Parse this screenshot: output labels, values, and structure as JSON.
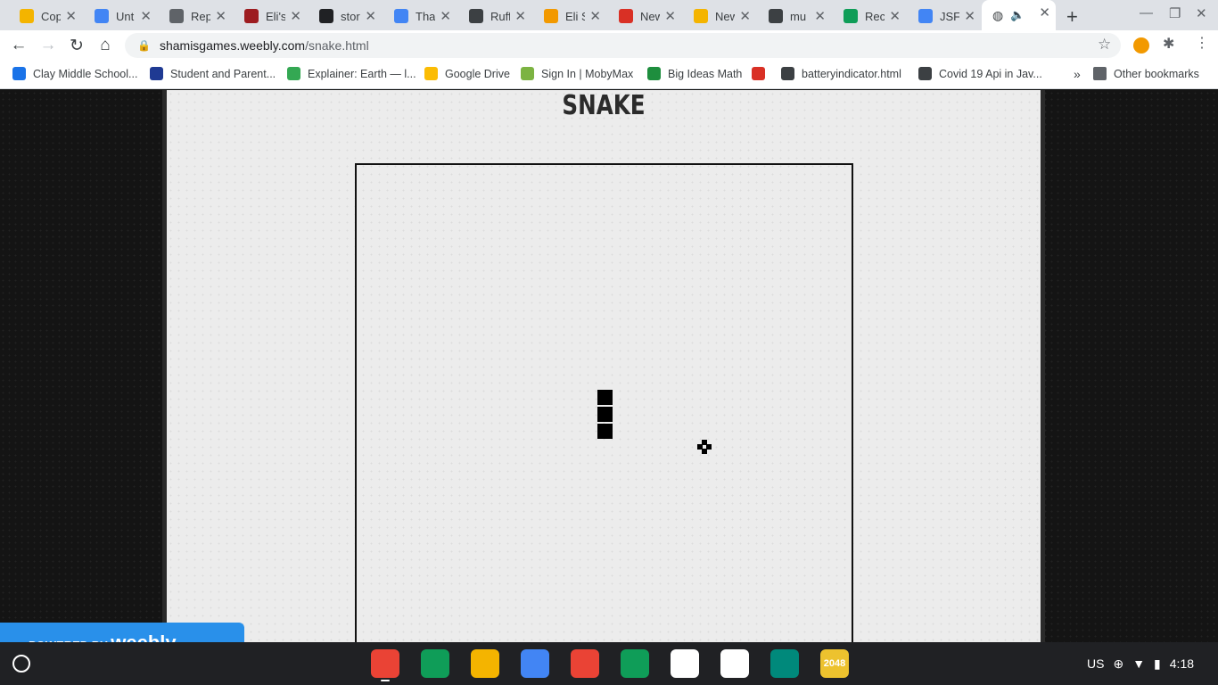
{
  "tabs": [
    {
      "title": "Cop",
      "icon": "slides-icon",
      "color": "#f4b400"
    },
    {
      "title": "Unt",
      "icon": "docs-icon",
      "color": "#4285f4"
    },
    {
      "title": "Rep",
      "icon": "replit-icon",
      "color": "#5f6368"
    },
    {
      "title": "Eli's",
      "icon": "flash-icon",
      "color": "#9d1c20"
    },
    {
      "title": "stor",
      "icon": "blackboard-icon",
      "color": "#202124"
    },
    {
      "title": "Tha",
      "icon": "docs-icon",
      "color": "#4285f4"
    },
    {
      "title": "Ruff",
      "icon": "globe-icon",
      "color": "#3c4043"
    },
    {
      "title": "Eli S",
      "icon": "scratch-icon",
      "color": "#f29900"
    },
    {
      "title": "New",
      "icon": "loading-icon",
      "color": "#d93025"
    },
    {
      "title": "New",
      "icon": "slides-icon",
      "color": "#f4b400"
    },
    {
      "title": "mu",
      "icon": "globe-icon",
      "color": "#3c4043"
    },
    {
      "title": "Rec",
      "icon": "drive-icon",
      "color": "#0f9d58"
    },
    {
      "title": "JSF",
      "icon": "cloud-icon",
      "color": "#4285f4"
    }
  ],
  "active_tab": {
    "icon": "globe-icon",
    "audio": "speaker-icon"
  },
  "omnibox": {
    "host": "shamisgames.weebly.com",
    "path": "/snake.html"
  },
  "bookmarks": [
    {
      "label": "Clay Middle School...",
      "color": "#1a73e8"
    },
    {
      "label": "Student and Parent...",
      "color": "#1f3a93"
    },
    {
      "label": "Explainer: Earth — l...",
      "color": "#34a853"
    },
    {
      "label": "Google Drive",
      "color": "#fbbc04"
    },
    {
      "label": "Sign In | MobyMax",
      "color": "#7cb342"
    },
    {
      "label": "Big Ideas Math",
      "color": "#1e8e3e"
    },
    {
      "label": "",
      "color": "#d93025"
    },
    {
      "label": "batteryindicator.html",
      "color": "#3c4043"
    },
    {
      "label": "Covid 19 Api in Jav...",
      "color": "#3c4043"
    }
  ],
  "bookmarks_more": "»",
  "other_bookmarks": "Other bookmarks",
  "page": {
    "title": "SNAKE",
    "badge_prefix": "POWERED BY",
    "badge_brand": "weebly"
  },
  "game": {
    "snake_length": 3
  },
  "shelf": {
    "apps": [
      {
        "name": "chrome-icon",
        "color": "#ea4335"
      },
      {
        "name": "drive-icon",
        "color": "#0f9d58"
      },
      {
        "name": "slides-icon",
        "color": "#f4b400"
      },
      {
        "name": "docs-icon",
        "color": "#4285f4"
      },
      {
        "name": "photos-icon",
        "color": "#ea4335"
      },
      {
        "name": "sheets-icon",
        "color": "#0f9d58"
      },
      {
        "name": "wikipedia-icon",
        "color": "#ffffff"
      },
      {
        "name": "notes-icon",
        "color": "#ffffff"
      },
      {
        "name": "clipboard-icon",
        "color": "#00897b"
      },
      {
        "name": "2048-icon",
        "color": "#edc22e",
        "label": "2048"
      }
    ],
    "keyboard": "US",
    "time": "4:18"
  }
}
